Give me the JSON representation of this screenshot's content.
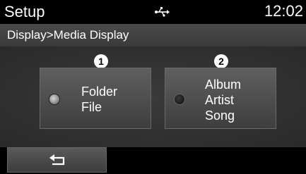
{
  "header": {
    "title": "Setup",
    "status_icon": "usb-icon",
    "time": "12:02"
  },
  "breadcrumb": {
    "text": "Display>Media Display"
  },
  "options": [
    {
      "marker": "1",
      "lines": [
        "Folder",
        "File"
      ],
      "selected": true
    },
    {
      "marker": "2",
      "lines": [
        "Album",
        "Artist",
        "Song"
      ],
      "selected": false
    }
  ],
  "footer": {
    "back_icon": "return-arrow-icon"
  }
}
